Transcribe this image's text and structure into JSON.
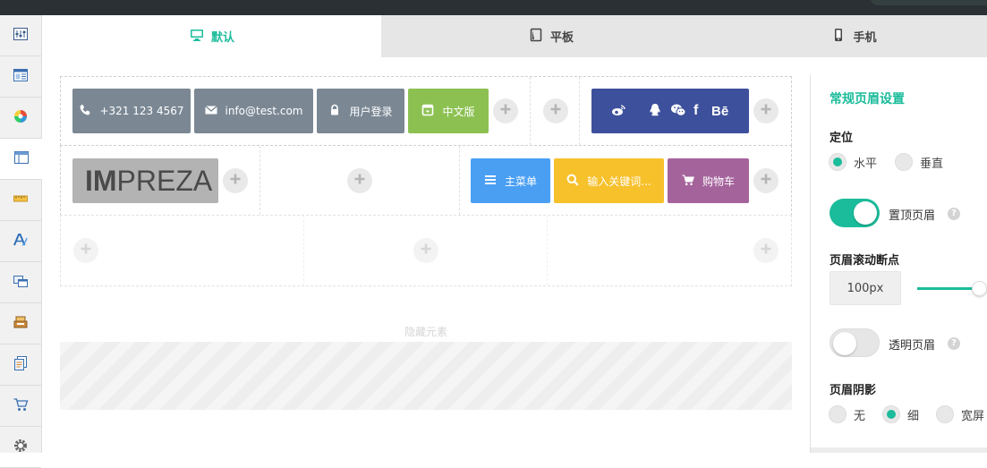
{
  "tabs": [
    {
      "label": "默认",
      "icon": "desktop-icon"
    },
    {
      "label": "平板",
      "icon": "tablet-icon"
    },
    {
      "label": "手机",
      "icon": "mobile-icon"
    }
  ],
  "sidebar": {
    "items": [
      {
        "icon": "sliders-icon"
      },
      {
        "icon": "layout-icon"
      },
      {
        "icon": "color-wheel-icon"
      },
      {
        "icon": "header-layout-icon"
      },
      {
        "icon": "ruler-icon"
      },
      {
        "icon": "typography-icon"
      },
      {
        "icon": "windows-icon"
      },
      {
        "icon": "cash-register-icon"
      },
      {
        "icon": "documents-icon"
      },
      {
        "icon": "cart-icon"
      },
      {
        "icon": "gear-icon"
      }
    ]
  },
  "header_builder": {
    "row1": {
      "phone_label": "+321 123 4567",
      "email_label": "info@test.com",
      "login_label": "用户登录",
      "language_label": "中文版",
      "social_behance": "Bē"
    },
    "row2": {
      "logo_text_bold": "IM",
      "logo_text_light": "PREZA",
      "menu_label": "主菜单",
      "search_label": "输入关键词...",
      "cart_label": "购物车"
    },
    "hidden_elements_label": "隐藏元素"
  },
  "colors": {
    "accent": "#1bbc9b",
    "contact_button": "#7b8894",
    "language_button": "#8cc152",
    "social_button": "#3d509b",
    "menu_button": "#4a9ff3",
    "search_button": "#f7c12c",
    "cart_button": "#a5639c"
  },
  "settings": {
    "title": "常规页眉设置",
    "orientation": {
      "label": "定位",
      "options": [
        "水平",
        "垂直"
      ],
      "selected": "水平"
    },
    "sticky_header": {
      "label": "置顶页眉",
      "on": true
    },
    "scroll_breakpoint": {
      "label": "页眉滚动断点",
      "value": "100px"
    },
    "transparent_header": {
      "label": "透明页眉",
      "on": false
    },
    "header_shadow": {
      "label": "页眉阴影",
      "options": [
        "无",
        "细",
        "宽屏"
      ],
      "selected": "细"
    }
  }
}
